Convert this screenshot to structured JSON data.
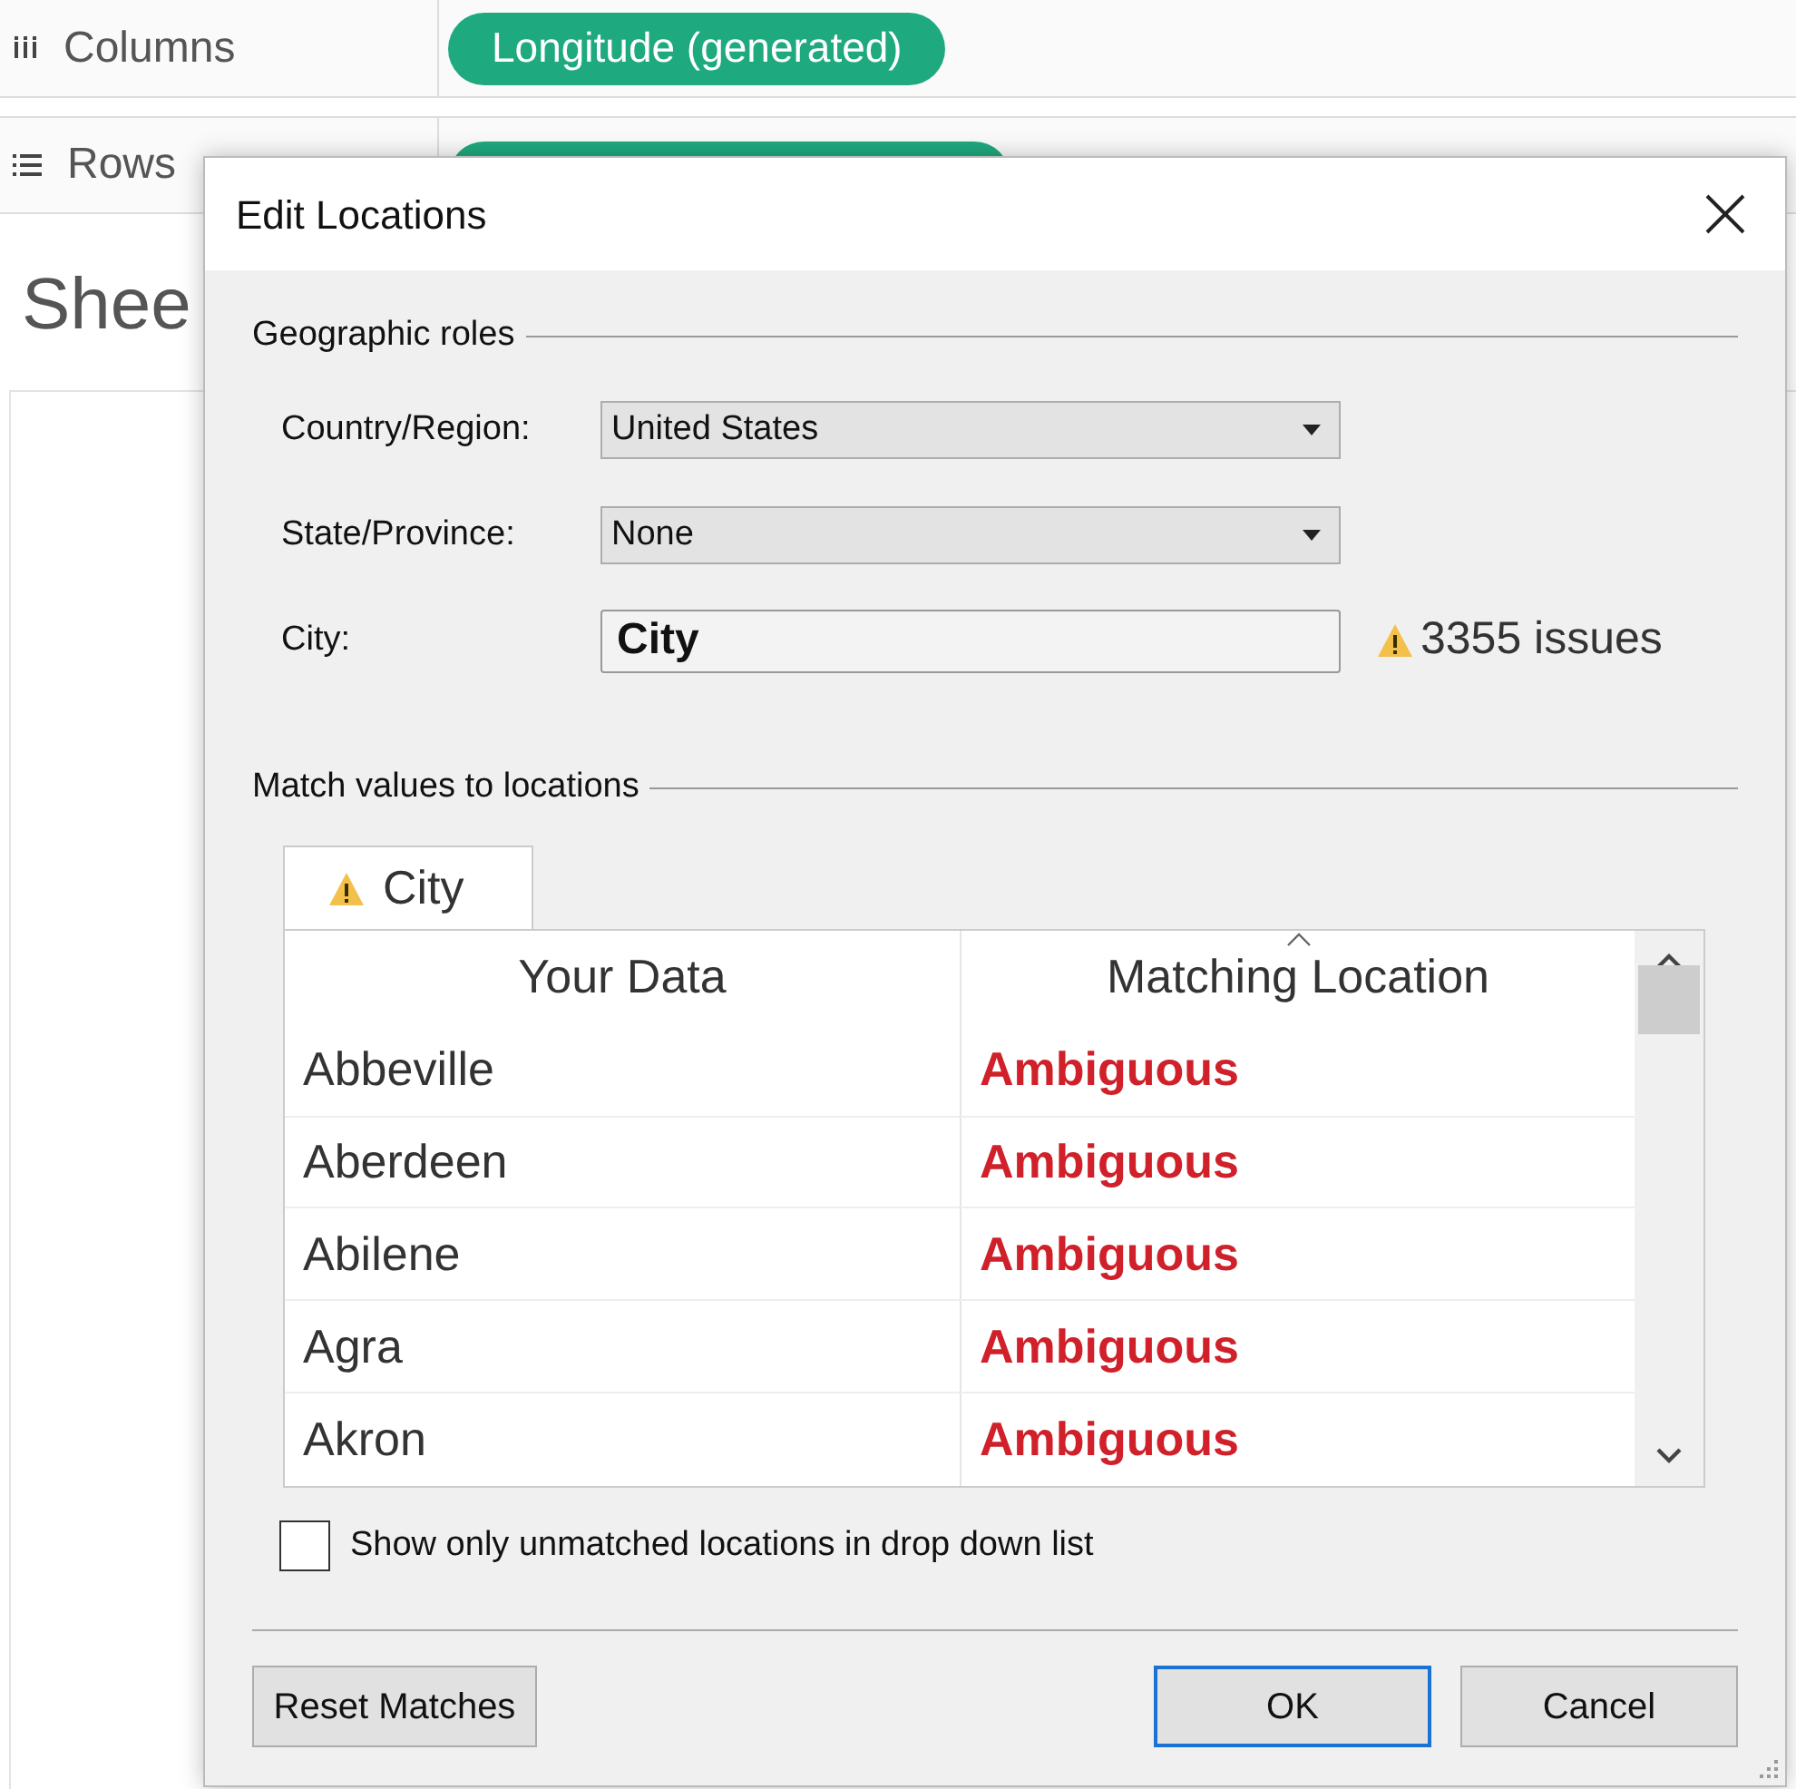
{
  "shelves": [
    {
      "kind": "columns",
      "label": "Columns",
      "pill": "Longitude (generated)"
    },
    {
      "kind": "rows",
      "label": "Rows"
    }
  ],
  "sheet_title": "Shee",
  "dialog": {
    "title": "Edit Locations",
    "geographic_roles": {
      "heading": "Geographic roles",
      "fields": [
        {
          "kind": "dropdown",
          "label": "Country/Region:",
          "value": "United States"
        },
        {
          "kind": "dropdown",
          "label": "State/Province:",
          "value": "None"
        },
        {
          "kind": "text",
          "label": "City:",
          "value": "City",
          "issues": "3355 issues"
        }
      ]
    },
    "match": {
      "heading": "Match values to locations",
      "tabs": [
        {
          "label": "City",
          "selected": true
        }
      ],
      "columns": [
        "Your Data",
        "Matching Location"
      ],
      "rows": [
        {
          "your_data": "Abbeville",
          "matching_location": "Ambiguous"
        },
        {
          "your_data": "Aberdeen",
          "matching_location": "Ambiguous"
        },
        {
          "your_data": "Abilene",
          "matching_location": "Ambiguous"
        },
        {
          "your_data": "Agra",
          "matching_location": "Ambiguous"
        },
        {
          "your_data": "Akron",
          "matching_location": "Ambiguous"
        }
      ],
      "unmatched_only": {
        "label": "Show only unmatched locations in drop down list",
        "checked": false
      }
    },
    "buttons": [
      {
        "kind": "normal",
        "label": "Reset Matches"
      },
      {
        "kind": "spacer"
      },
      {
        "kind": "default",
        "label": "OK"
      },
      {
        "kind": "normal",
        "label": "Cancel"
      }
    ]
  }
}
